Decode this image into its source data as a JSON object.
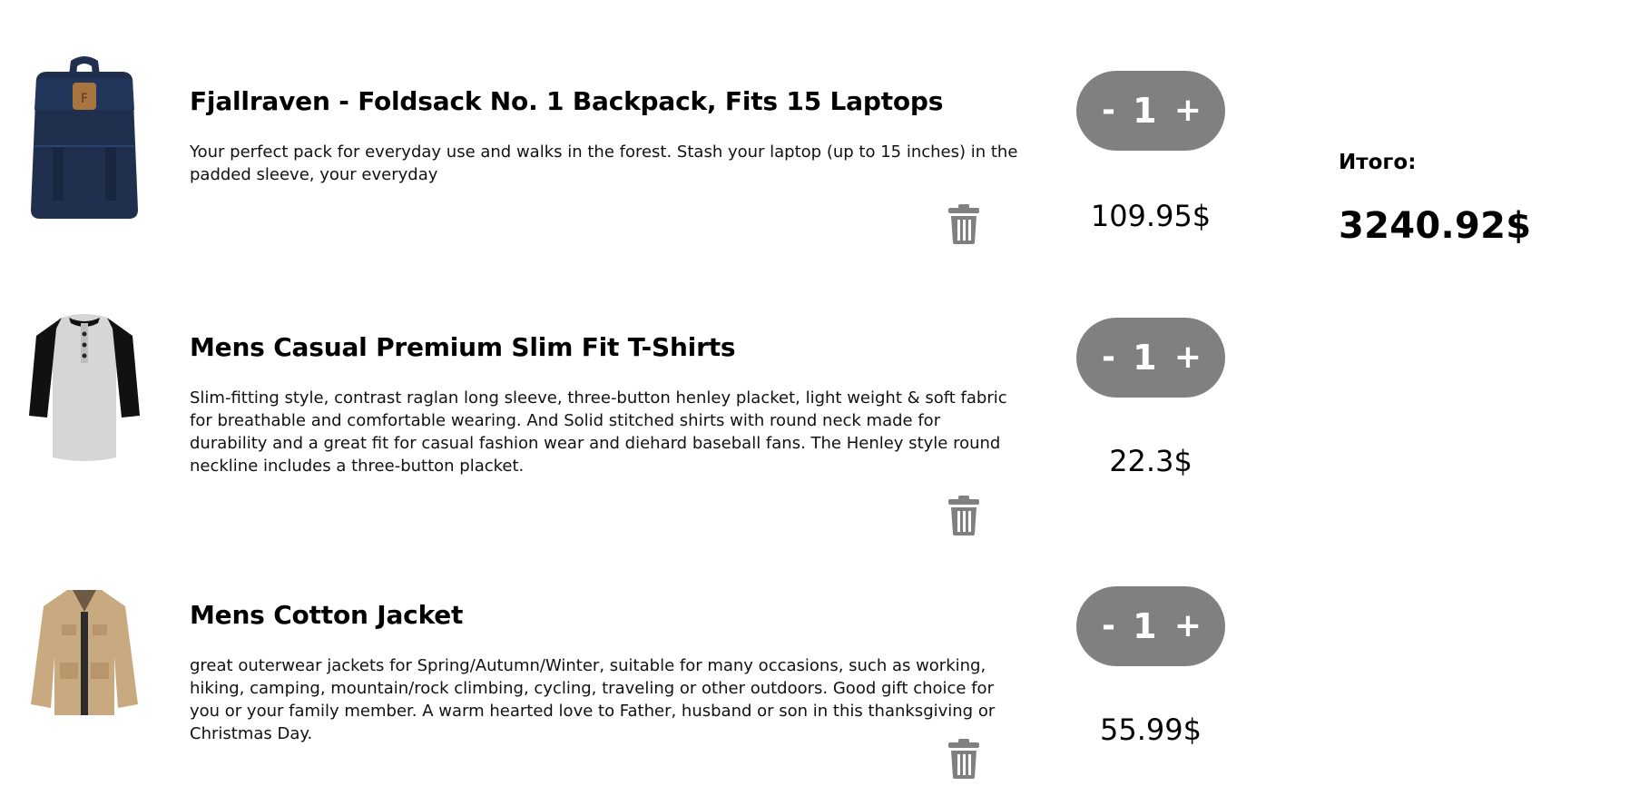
{
  "cart": {
    "items": [
      {
        "title": "Fjallraven - Foldsack No. 1 Backpack, Fits 15 Laptops",
        "description": "Your perfect pack for everyday use and walks in the forest. Stash your laptop (up to 15 inches) in the padded sleeve, your everyday",
        "quantity": "1",
        "minus_label": "-",
        "plus_label": "+",
        "price": "109.95$",
        "image_icon": "backpack-image"
      },
      {
        "title": "Mens Casual Premium Slim Fit T-Shirts",
        "description": "Slim-fitting style, contrast raglan long sleeve, three-button henley placket, light weight & soft fabric for breathable and comfortable wearing. And Solid stitched shirts with round neck made for durability and a great fit for casual fashion wear and diehard baseball fans. The Henley style round neckline includes a three-button placket.",
        "quantity": "1",
        "minus_label": "-",
        "plus_label": "+",
        "price": "22.3$",
        "image_icon": "tshirt-image"
      },
      {
        "title": "Mens Cotton Jacket",
        "description": "great outerwear jackets for Spring/Autumn/Winter, suitable for many occasions, such as working, hiking, camping, mountain/rock climbing, cycling, traveling or other outdoors. Good gift choice for you or your family member. A warm hearted love to Father, husband or son in this thanksgiving or Christmas Day.",
        "quantity": "1",
        "minus_label": "-",
        "plus_label": "+",
        "price": "55.99$",
        "image_icon": "jacket-image"
      }
    ]
  },
  "summary": {
    "total_label": "Итого:",
    "total_value": "3240.92$"
  },
  "colors": {
    "quantity_pill": "#808080",
    "trash_icon": "#808080",
    "backpack": "#1f2f4d",
    "backpack_patch": "#a8743f",
    "tshirt_body": "#d6d6d6",
    "tshirt_sleeve": "#111111",
    "jacket": "#c9a97f"
  }
}
